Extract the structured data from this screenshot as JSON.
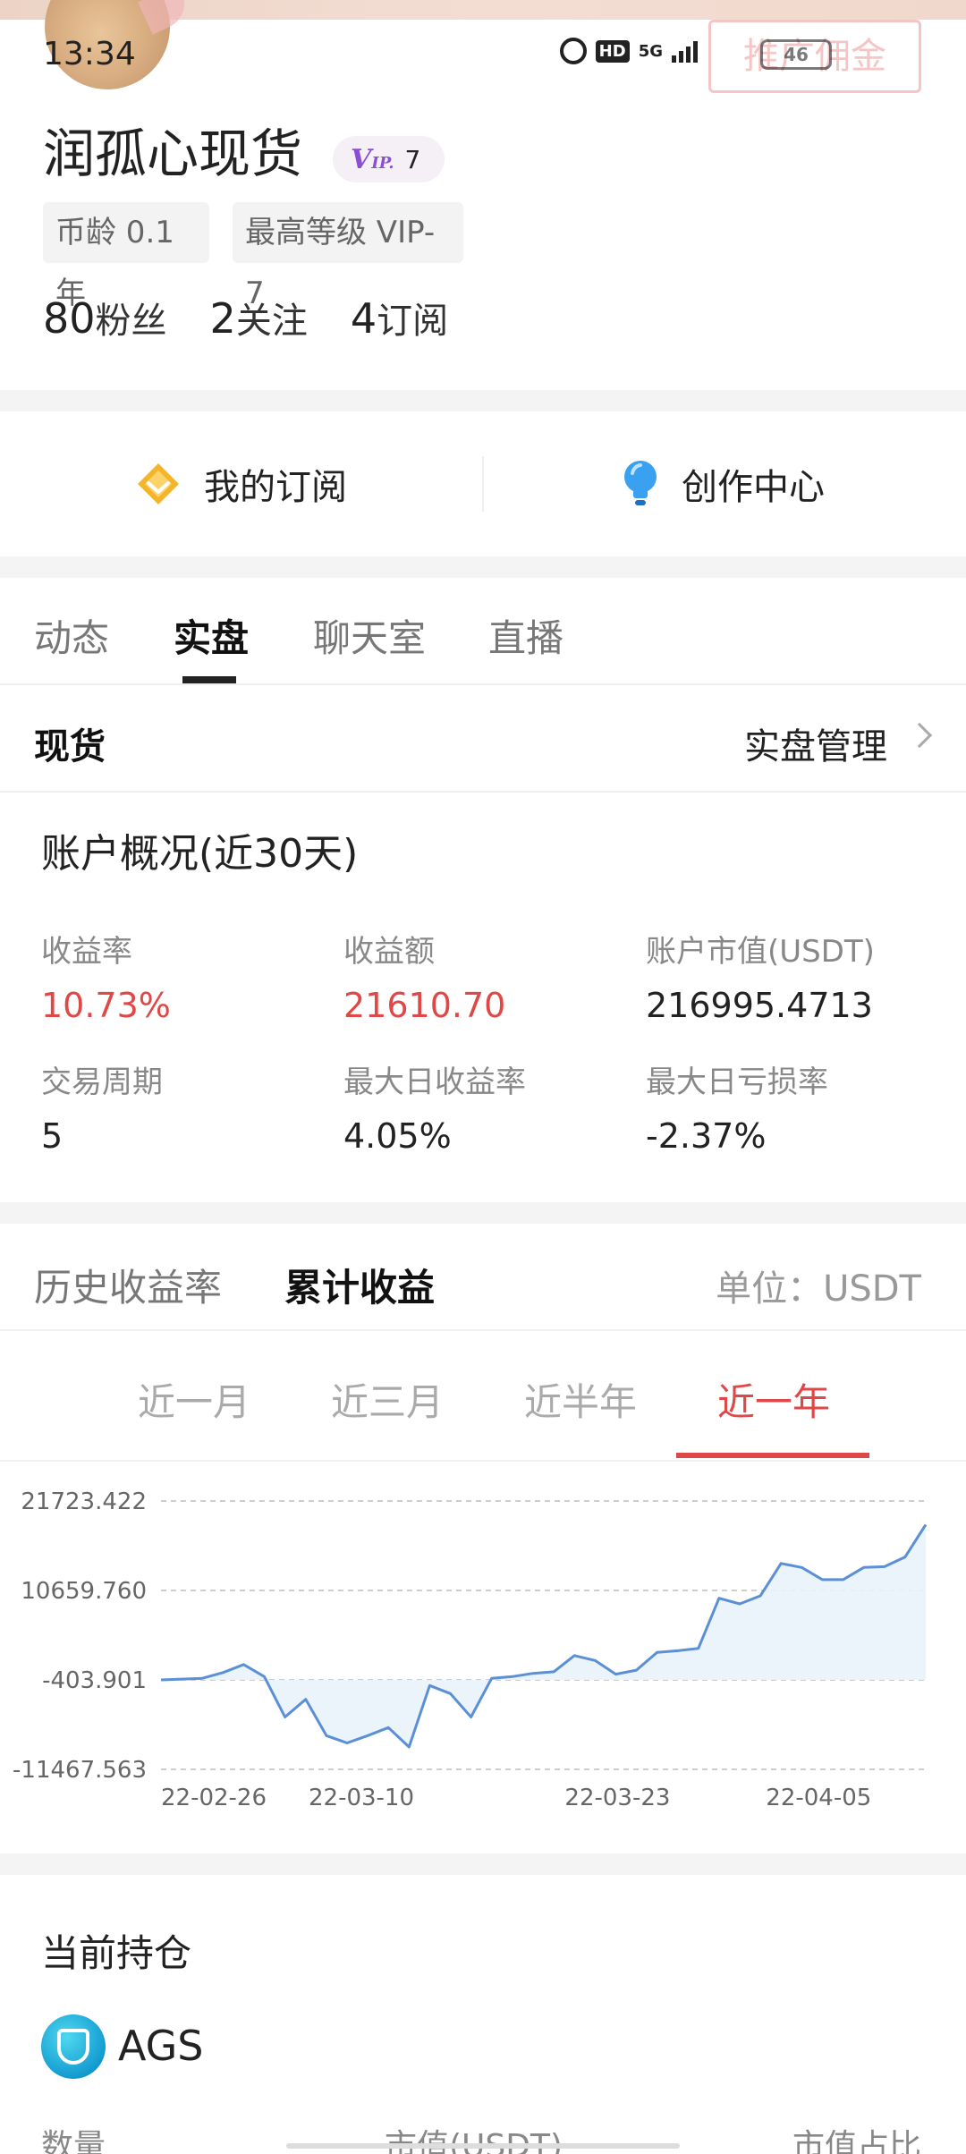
{
  "status_bar": {
    "time": "13:34",
    "hd_label": "HD",
    "network": "5G",
    "battery": "46"
  },
  "profile": {
    "promo_button": "推广佣金",
    "username": "润孤心现货",
    "vip_level": "7",
    "tag_age": "币龄 0.1年",
    "tag_level": "最高等级 VIP-7",
    "followers_num": "80",
    "followers_label": "粉丝",
    "following_num": "2",
    "following_label": "关注",
    "subscriptions_num": "4",
    "subscriptions_label": "订阅"
  },
  "shortcuts": {
    "my_subscription": "我的订阅",
    "creator_center": "创作中心"
  },
  "tabs": [
    "动态",
    "实盘",
    "聊天室",
    "直播"
  ],
  "active_tab": "实盘",
  "spot": {
    "title": "现货",
    "manage": "实盘管理"
  },
  "overview": {
    "title": "账户概况(近30天)",
    "metrics": [
      {
        "label": "收益率",
        "value": "10.73%"
      },
      {
        "label": "收益额",
        "value": "21610.70"
      },
      {
        "label": "账户市值(USDT)",
        "value": "216995.4713"
      },
      {
        "label": "交易周期",
        "value": "5"
      },
      {
        "label": "最大日收益率",
        "value": "4.05%"
      },
      {
        "label": "最大日亏损率",
        "value": "-2.37%"
      }
    ]
  },
  "cumulative": {
    "tab_history": "历史收益率",
    "tab_cumulative": "累计收益",
    "unit": "单位：USDT",
    "ranges": [
      "近一月",
      "近三月",
      "近半年",
      "近一年"
    ],
    "active_range": "近一年"
  },
  "colors": {
    "accent_red": "#e04848",
    "line_blue": "#5b8fd6",
    "fill_blue": "#e9f3fb"
  },
  "chart_data": {
    "type": "area",
    "title": "",
    "xlabel": "",
    "ylabel": "",
    "y_ticks": [
      "21723.422",
      "10659.760",
      "-403.901",
      "-11467.563"
    ],
    "x_ticks": [
      "22-02-26",
      "22-03-10",
      "22-03-23",
      "22-04-05"
    ],
    "ylim": [
      -11467.563,
      21723.422
    ],
    "series": [
      {
        "values": [
          -403.9,
          -300,
          -200,
          500,
          1500,
          0,
          -5000,
          -2800,
          -7300,
          -8200,
          -7300,
          -6300,
          -8700,
          -1100,
          -2100,
          -5000,
          -200,
          0,
          400,
          600,
          2600,
          2000,
          300,
          800,
          3000,
          3200,
          3500,
          9700,
          9000,
          10000,
          14000,
          13500,
          12000,
          12000,
          13500,
          13600,
          14800,
          18800
        ]
      }
    ]
  },
  "holdings": {
    "title": "当前持仓",
    "coin": "AGS",
    "col_quantity": "数量",
    "col_market_value": "市值(USDT)",
    "col_ratio": "市值占比"
  }
}
